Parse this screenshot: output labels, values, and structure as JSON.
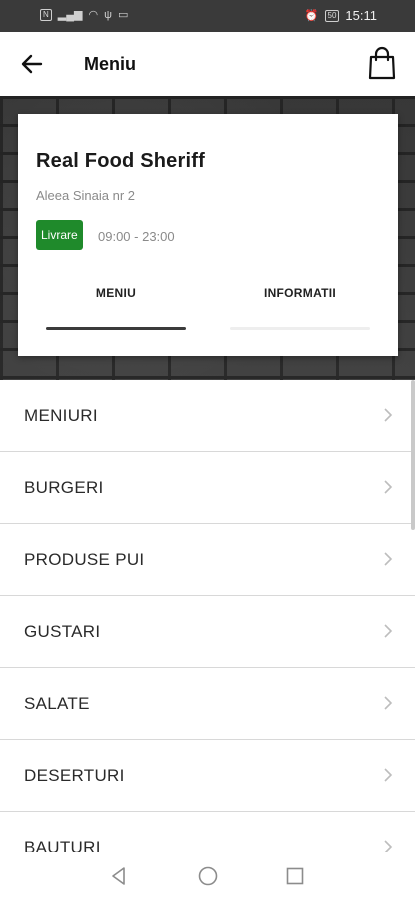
{
  "status_bar": {
    "left_chips": [
      "N",
      "",
      ""
    ],
    "right_battery": "50",
    "time": "15:11"
  },
  "app_bar": {
    "title": "Meniu",
    "back_icon": "arrow-left-icon",
    "cart_icon": "shopping-bag-icon"
  },
  "restaurant": {
    "name": "Real Food Sheriff",
    "address": "Aleea Sinaia nr 2",
    "delivery_badge": "Livrare",
    "hours": "09:00 - 23:00"
  },
  "tabs": [
    {
      "label": "MENIU",
      "active": true
    },
    {
      "label": "INFORMATII",
      "active": false
    }
  ],
  "categories": [
    {
      "label": "MENIURI"
    },
    {
      "label": "BURGERI"
    },
    {
      "label": "PRODUSE PUI"
    },
    {
      "label": "GUSTARI"
    },
    {
      "label": "SALATE"
    },
    {
      "label": "DESERTURI"
    },
    {
      "label": "BAUTURI"
    }
  ],
  "colors": {
    "badge_green": "#1f8a2b",
    "active_tab_indicator": "#3b3b3b",
    "status_bar": "#3a3a3a"
  }
}
